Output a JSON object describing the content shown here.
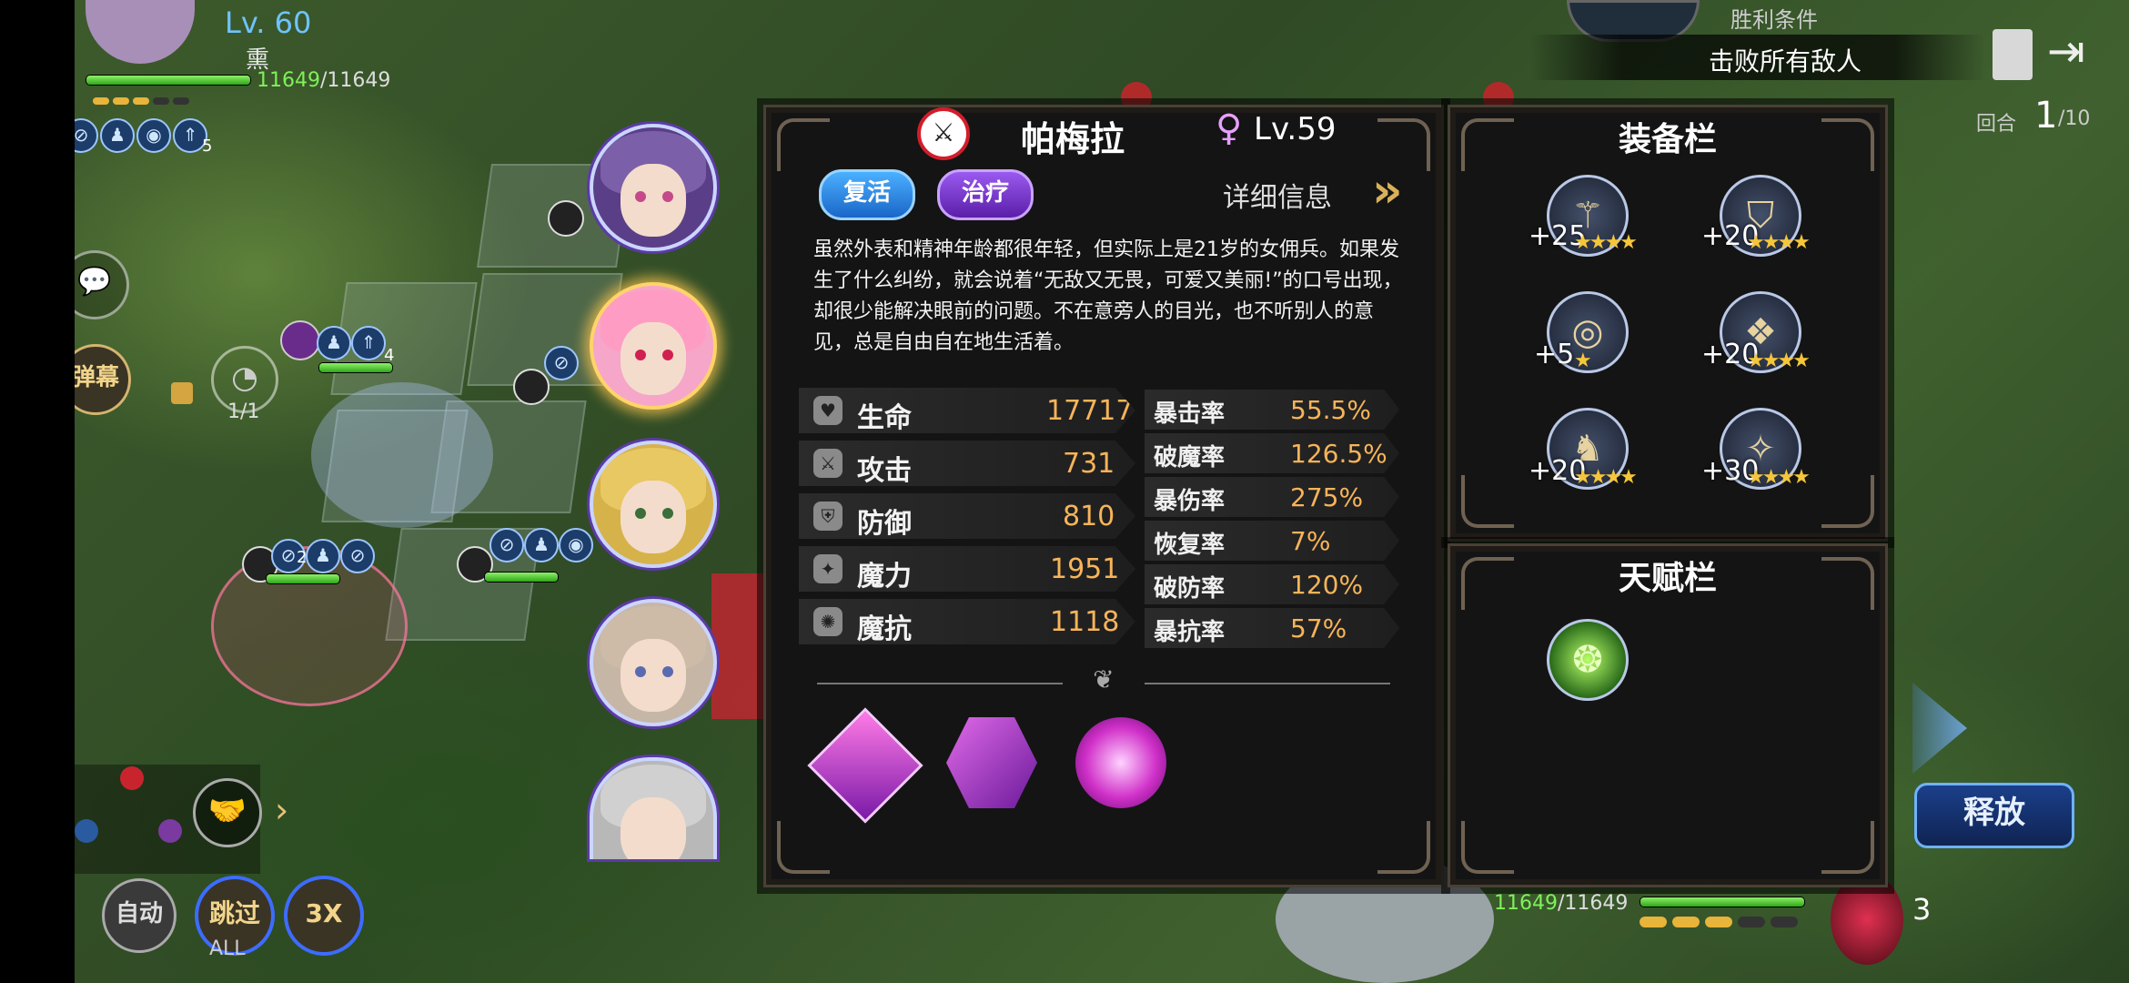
{
  "player": {
    "level": "Lv. 60",
    "name": "熏",
    "hp_current": "11649",
    "hp_max": "/11649",
    "buff_count": "5"
  },
  "victory": {
    "label": "胜利条件",
    "condition": "击败所有敌人"
  },
  "round": {
    "label": "回合",
    "current": "1",
    "total": "/10"
  },
  "left_controls": {
    "danmaku": "弹幕",
    "charge_count": "1/1",
    "auto": "自动",
    "skip": "跳过",
    "skip_sub": "ALL",
    "speed": "3X"
  },
  "unit_marks": {
    "a": "4",
    "b": "2"
  },
  "hero": {
    "name": "帕梅拉",
    "level": "Lv.59",
    "tags": [
      "复活",
      "治疗"
    ],
    "detail_link": "详细信息",
    "description": "虽然外表和精神年龄都很年轻，但实际上是21岁的女佣兵。如果发生了什么纠纷，就会说着“无敌又无畏，可爱又美丽!”的口号出现，却很少能解决眼前的问题。不在意旁人的目光，也不听别人的意见，总是自由自在地生活着。",
    "stats": [
      {
        "name": "生命",
        "value": "17717",
        "icon": "heart-icon"
      },
      {
        "name": "攻击",
        "value": "731",
        "icon": "sword-icon"
      },
      {
        "name": "防御",
        "value": "810",
        "icon": "shield-icon"
      },
      {
        "name": "魔力",
        "value": "1951",
        "icon": "magic-icon"
      },
      {
        "name": "魔抗",
        "value": "1118",
        "icon": "magic-resist-icon"
      }
    ],
    "rates": [
      {
        "name": "暴击率",
        "value": "55.5%"
      },
      {
        "name": "破魔率",
        "value": "126.5%"
      },
      {
        "name": "暴伤率",
        "value": "275%"
      },
      {
        "name": "恢复率",
        "value": "7%"
      },
      {
        "name": "破防率",
        "value": "120%"
      },
      {
        "name": "暴抗率",
        "value": "57%"
      }
    ]
  },
  "equipment": {
    "title": "装备栏",
    "items": [
      {
        "plus": "+25",
        "stars": 4,
        "icon": "staff-icon"
      },
      {
        "plus": "+20",
        "stars": 4,
        "icon": "armor-icon"
      },
      {
        "plus": "+5",
        "stars": 1,
        "icon": "ring-icon"
      },
      {
        "plus": "+20",
        "stars": 4,
        "icon": "gem-icon"
      },
      {
        "plus": "+20",
        "stars": 4,
        "icon": "boots-icon"
      },
      {
        "plus": "+30",
        "stars": 4,
        "icon": "amulet-icon"
      }
    ]
  },
  "talent": {
    "title": "天赋栏"
  },
  "ally": {
    "hp_current": "11649",
    "hp_max": "/11649",
    "count": "3"
  },
  "release_button": "释放"
}
